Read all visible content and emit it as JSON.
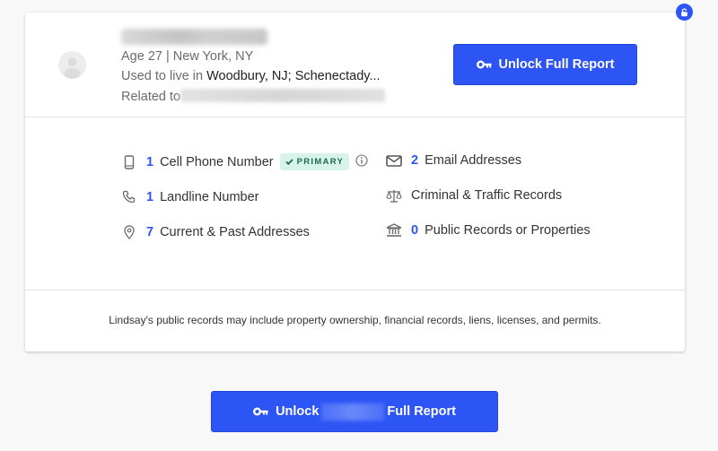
{
  "profile": {
    "age_location": "Age 27  |  New York, NY",
    "used_to_live_prefix": "Used to live in ",
    "used_to_live_places": "Woodbury, NJ; Schenectady...",
    "related_prefix": "Related to"
  },
  "header": {
    "unlock_button_label": "Unlock Full Report"
  },
  "features": {
    "left": [
      {
        "icon": "cell-phone-icon",
        "count": "1",
        "label": "Cell Phone Number",
        "badge": "PRIMARY"
      },
      {
        "icon": "phone-icon",
        "count": "1",
        "label": "Landline Number"
      },
      {
        "icon": "location-pin-icon",
        "count": "7",
        "label": "Current & Past Addresses"
      }
    ],
    "right": [
      {
        "icon": "envelope-icon",
        "count": "2",
        "label": "Email Addresses"
      },
      {
        "icon": "scales-icon",
        "count": "",
        "label": "Criminal & Traffic Records"
      },
      {
        "icon": "bank-icon",
        "count": "0",
        "label": "Public Records or Properties"
      }
    ]
  },
  "footnote": "Lindsay's public records may include property ownership, financial records, liens, licenses, and permits.",
  "bottom_button": {
    "prefix": "Unlock",
    "suffix": "Full Report"
  },
  "colors": {
    "accent": "#2d55f5",
    "badge_bg": "#d8f3ea",
    "badge_text": "#1f6a4f"
  }
}
